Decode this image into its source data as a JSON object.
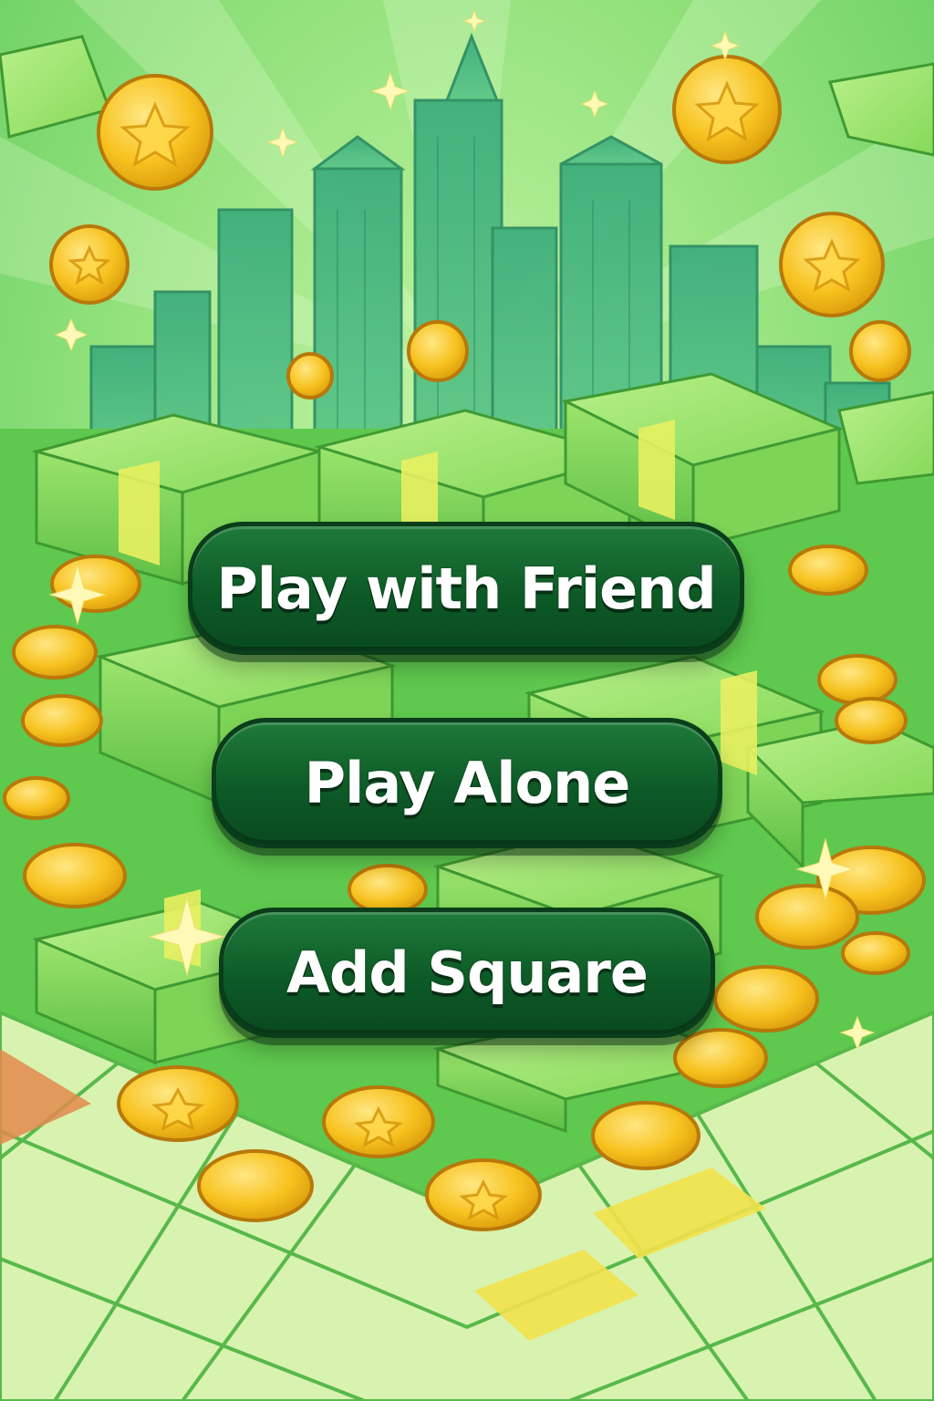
{
  "menu": {
    "play_with_friend": "Play with Friend",
    "play_alone": "Play Alone",
    "add_square": "Add Square"
  },
  "colors": {
    "button_green": "#0d5a27",
    "background_green": "#7fdc6a",
    "coin_gold": "#f7c21f",
    "cash_green": "#8fe05a"
  },
  "icons": [
    "coin-icon",
    "sparkle-icon",
    "cash-stack-icon",
    "skyline-icon"
  ]
}
